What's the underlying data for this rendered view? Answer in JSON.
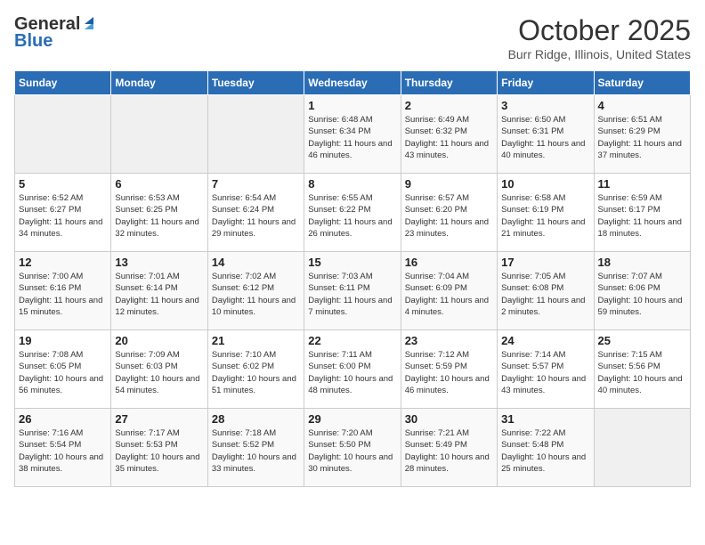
{
  "header": {
    "logo_general": "General",
    "logo_blue": "Blue",
    "title": "October 2025",
    "subtitle": "Burr Ridge, Illinois, United States"
  },
  "weekdays": [
    "Sunday",
    "Monday",
    "Tuesday",
    "Wednesday",
    "Thursday",
    "Friday",
    "Saturday"
  ],
  "weeks": [
    [
      {
        "day": "",
        "sunrise": "",
        "sunset": "",
        "daylight": ""
      },
      {
        "day": "",
        "sunrise": "",
        "sunset": "",
        "daylight": ""
      },
      {
        "day": "",
        "sunrise": "",
        "sunset": "",
        "daylight": ""
      },
      {
        "day": "1",
        "sunrise": "Sunrise: 6:48 AM",
        "sunset": "Sunset: 6:34 PM",
        "daylight": "Daylight: 11 hours and 46 minutes."
      },
      {
        "day": "2",
        "sunrise": "Sunrise: 6:49 AM",
        "sunset": "Sunset: 6:32 PM",
        "daylight": "Daylight: 11 hours and 43 minutes."
      },
      {
        "day": "3",
        "sunrise": "Sunrise: 6:50 AM",
        "sunset": "Sunset: 6:31 PM",
        "daylight": "Daylight: 11 hours and 40 minutes."
      },
      {
        "day": "4",
        "sunrise": "Sunrise: 6:51 AM",
        "sunset": "Sunset: 6:29 PM",
        "daylight": "Daylight: 11 hours and 37 minutes."
      }
    ],
    [
      {
        "day": "5",
        "sunrise": "Sunrise: 6:52 AM",
        "sunset": "Sunset: 6:27 PM",
        "daylight": "Daylight: 11 hours and 34 minutes."
      },
      {
        "day": "6",
        "sunrise": "Sunrise: 6:53 AM",
        "sunset": "Sunset: 6:25 PM",
        "daylight": "Daylight: 11 hours and 32 minutes."
      },
      {
        "day": "7",
        "sunrise": "Sunrise: 6:54 AM",
        "sunset": "Sunset: 6:24 PM",
        "daylight": "Daylight: 11 hours and 29 minutes."
      },
      {
        "day": "8",
        "sunrise": "Sunrise: 6:55 AM",
        "sunset": "Sunset: 6:22 PM",
        "daylight": "Daylight: 11 hours and 26 minutes."
      },
      {
        "day": "9",
        "sunrise": "Sunrise: 6:57 AM",
        "sunset": "Sunset: 6:20 PM",
        "daylight": "Daylight: 11 hours and 23 minutes."
      },
      {
        "day": "10",
        "sunrise": "Sunrise: 6:58 AM",
        "sunset": "Sunset: 6:19 PM",
        "daylight": "Daylight: 11 hours and 21 minutes."
      },
      {
        "day": "11",
        "sunrise": "Sunrise: 6:59 AM",
        "sunset": "Sunset: 6:17 PM",
        "daylight": "Daylight: 11 hours and 18 minutes."
      }
    ],
    [
      {
        "day": "12",
        "sunrise": "Sunrise: 7:00 AM",
        "sunset": "Sunset: 6:16 PM",
        "daylight": "Daylight: 11 hours and 15 minutes."
      },
      {
        "day": "13",
        "sunrise": "Sunrise: 7:01 AM",
        "sunset": "Sunset: 6:14 PM",
        "daylight": "Daylight: 11 hours and 12 minutes."
      },
      {
        "day": "14",
        "sunrise": "Sunrise: 7:02 AM",
        "sunset": "Sunset: 6:12 PM",
        "daylight": "Daylight: 11 hours and 10 minutes."
      },
      {
        "day": "15",
        "sunrise": "Sunrise: 7:03 AM",
        "sunset": "Sunset: 6:11 PM",
        "daylight": "Daylight: 11 hours and 7 minutes."
      },
      {
        "day": "16",
        "sunrise": "Sunrise: 7:04 AM",
        "sunset": "Sunset: 6:09 PM",
        "daylight": "Daylight: 11 hours and 4 minutes."
      },
      {
        "day": "17",
        "sunrise": "Sunrise: 7:05 AM",
        "sunset": "Sunset: 6:08 PM",
        "daylight": "Daylight: 11 hours and 2 minutes."
      },
      {
        "day": "18",
        "sunrise": "Sunrise: 7:07 AM",
        "sunset": "Sunset: 6:06 PM",
        "daylight": "Daylight: 10 hours and 59 minutes."
      }
    ],
    [
      {
        "day": "19",
        "sunrise": "Sunrise: 7:08 AM",
        "sunset": "Sunset: 6:05 PM",
        "daylight": "Daylight: 10 hours and 56 minutes."
      },
      {
        "day": "20",
        "sunrise": "Sunrise: 7:09 AM",
        "sunset": "Sunset: 6:03 PM",
        "daylight": "Daylight: 10 hours and 54 minutes."
      },
      {
        "day": "21",
        "sunrise": "Sunrise: 7:10 AM",
        "sunset": "Sunset: 6:02 PM",
        "daylight": "Daylight: 10 hours and 51 minutes."
      },
      {
        "day": "22",
        "sunrise": "Sunrise: 7:11 AM",
        "sunset": "Sunset: 6:00 PM",
        "daylight": "Daylight: 10 hours and 48 minutes."
      },
      {
        "day": "23",
        "sunrise": "Sunrise: 7:12 AM",
        "sunset": "Sunset: 5:59 PM",
        "daylight": "Daylight: 10 hours and 46 minutes."
      },
      {
        "day": "24",
        "sunrise": "Sunrise: 7:14 AM",
        "sunset": "Sunset: 5:57 PM",
        "daylight": "Daylight: 10 hours and 43 minutes."
      },
      {
        "day": "25",
        "sunrise": "Sunrise: 7:15 AM",
        "sunset": "Sunset: 5:56 PM",
        "daylight": "Daylight: 10 hours and 40 minutes."
      }
    ],
    [
      {
        "day": "26",
        "sunrise": "Sunrise: 7:16 AM",
        "sunset": "Sunset: 5:54 PM",
        "daylight": "Daylight: 10 hours and 38 minutes."
      },
      {
        "day": "27",
        "sunrise": "Sunrise: 7:17 AM",
        "sunset": "Sunset: 5:53 PM",
        "daylight": "Daylight: 10 hours and 35 minutes."
      },
      {
        "day": "28",
        "sunrise": "Sunrise: 7:18 AM",
        "sunset": "Sunset: 5:52 PM",
        "daylight": "Daylight: 10 hours and 33 minutes."
      },
      {
        "day": "29",
        "sunrise": "Sunrise: 7:20 AM",
        "sunset": "Sunset: 5:50 PM",
        "daylight": "Daylight: 10 hours and 30 minutes."
      },
      {
        "day": "30",
        "sunrise": "Sunrise: 7:21 AM",
        "sunset": "Sunset: 5:49 PM",
        "daylight": "Daylight: 10 hours and 28 minutes."
      },
      {
        "day": "31",
        "sunrise": "Sunrise: 7:22 AM",
        "sunset": "Sunset: 5:48 PM",
        "daylight": "Daylight: 10 hours and 25 minutes."
      },
      {
        "day": "",
        "sunrise": "",
        "sunset": "",
        "daylight": ""
      }
    ]
  ]
}
